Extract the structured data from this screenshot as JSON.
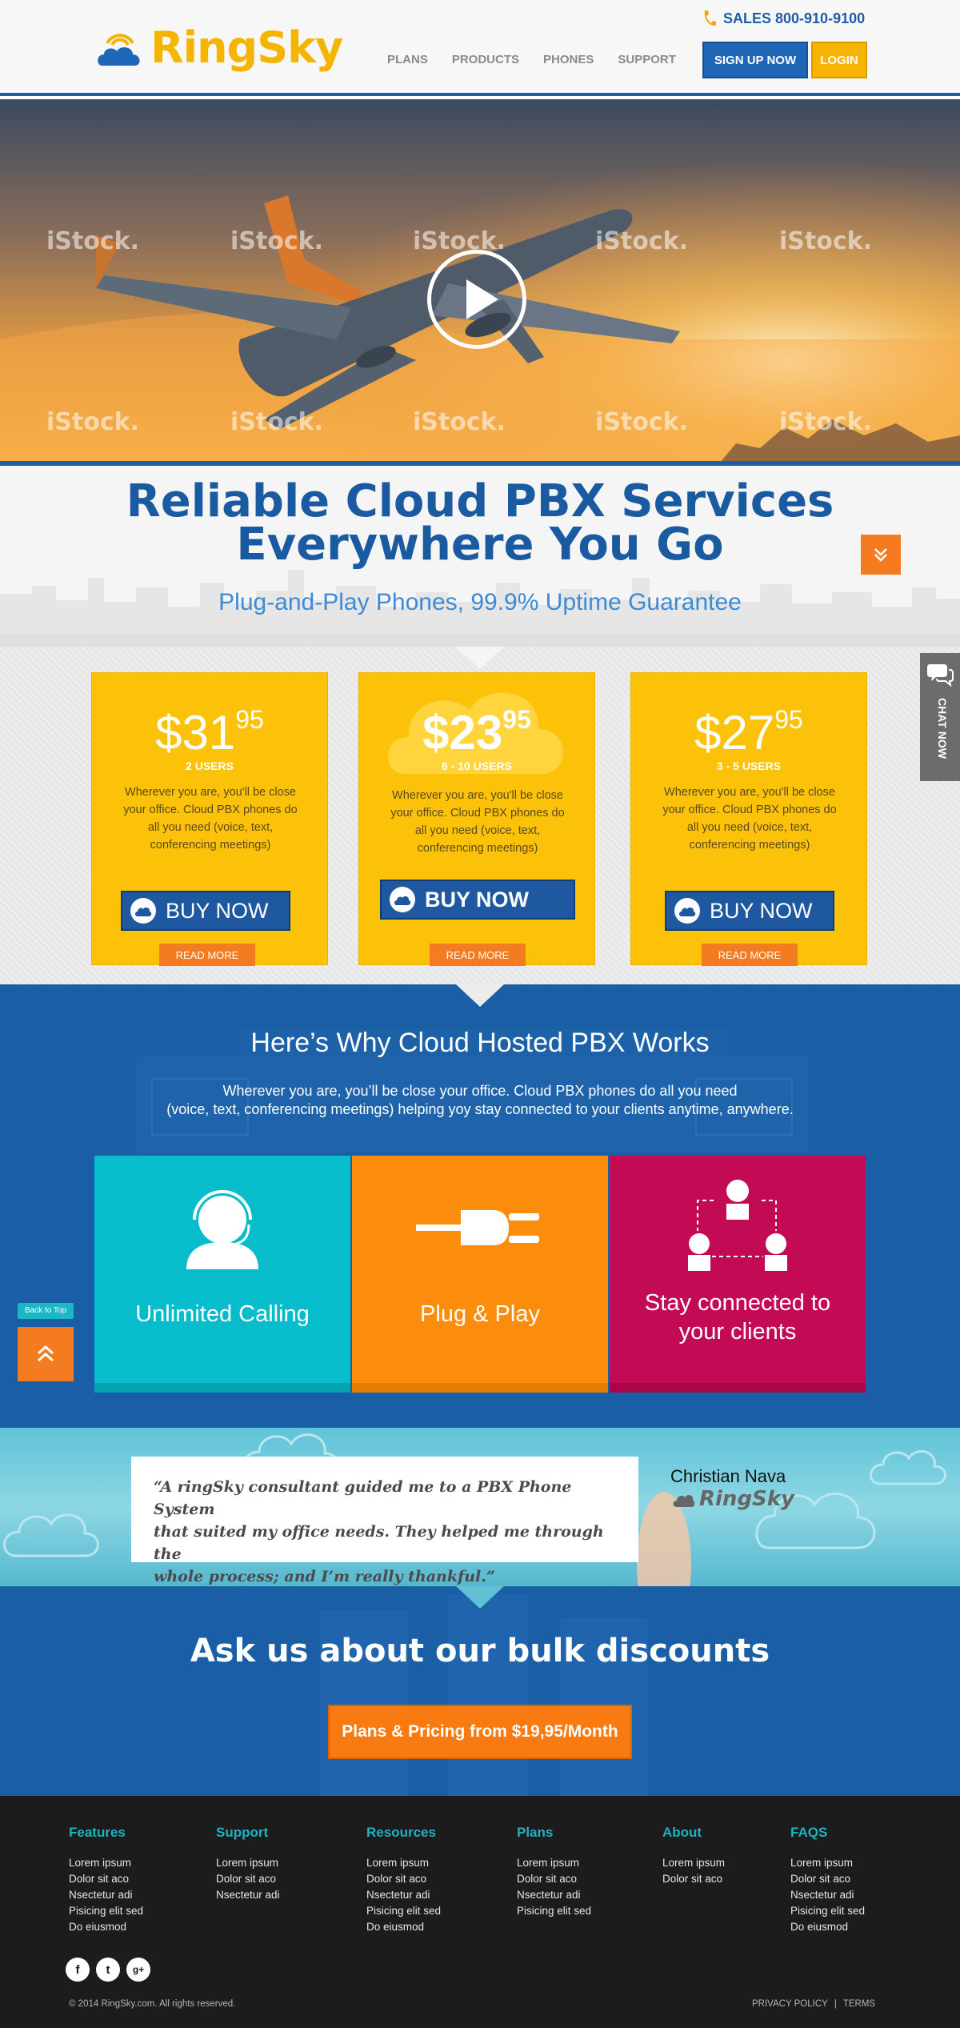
{
  "brand": {
    "name": "RingSky",
    "primary": "#1f5da8",
    "accent": "#f5b400",
    "orange": "#f47b20"
  },
  "header": {
    "nav": [
      "PLANS",
      "PRODUCTS",
      "PHONES",
      "SUPPORT"
    ],
    "sales": "SALES 800-910-9100",
    "signup": "SIGN UP NOW",
    "login": "LOGIN"
  },
  "hero": {
    "watermark": "iStock.",
    "play_icon": "play-icon"
  },
  "headline": {
    "line1": "Reliable Cloud PBX Services",
    "line2": "Everywhere You Go",
    "subtitle": "Plug-and-Play Phones, 99.9% Uptime Guarantee"
  },
  "plans": [
    {
      "dollars": "$31",
      "cents": "95",
      "users": "2 USERS",
      "desc": "Wherever you are, you'll be close your office. Cloud PBX phones do all you need (voice, text, conferencing meetings)",
      "buy": "BUY NOW",
      "more": "READ MORE"
    },
    {
      "dollars": "$23",
      "cents": "95",
      "users": "6 - 10 USERS",
      "desc": "Wherever you are, you'll be close your office. Cloud PBX phones do all you need (voice, text, conferencing meetings)",
      "buy": "BUY NOW",
      "more": "READ MORE"
    },
    {
      "dollars": "$27",
      "cents": "95",
      "users": "3 - 5 USERS",
      "desc": "Wherever you are, you'll be close your office. Cloud PBX phones do all you need (voice, text, conferencing meetings)",
      "buy": "BUY NOW",
      "more": "READ MORE"
    }
  ],
  "why": {
    "title": "Here’s Why Cloud Hosted PBX Works",
    "desc1": "Wherever you are, you’ll be close your office. Cloud PBX phones do all you need",
    "desc2": "(voice, text, conferencing meetings) helping yoy stay connected to your clients anytime, anywhere.",
    "tiles": [
      {
        "label": "Unlimited Calling",
        "color": "#07bccb"
      },
      {
        "label": "Plug & Play",
        "color": "#fb8c0c"
      },
      {
        "label1": "Stay connected to",
        "label2": "your clients",
        "color": "#c30a54"
      }
    ],
    "back_to_top": "Back to Top"
  },
  "testimonial": {
    "quote1": "“A ringSky consultant guided me to a PBX Phone System",
    "quote2": "that suited my office needs. They helped me through the",
    "quote3": "whole process; and I’m really thankful.”",
    "author": "Christian Nava",
    "company": "RingSky"
  },
  "bulk": {
    "title": "Ask  us about our bulk discounts",
    "button": "Plans & Pricing from $19,95/Month"
  },
  "chat": {
    "label": "CHAT NOW"
  },
  "footer": {
    "columns": [
      {
        "title": "Features",
        "links": [
          "Lorem ipsum",
          "Dolor sit aco",
          "Nsectetur adi",
          "Pisicing elit sed",
          "Do eiusmod"
        ]
      },
      {
        "title": "Support",
        "links": [
          "Lorem ipsum",
          "Dolor sit aco",
          "Nsectetur adi"
        ]
      },
      {
        "title": "Resources",
        "links": [
          "Lorem ipsum",
          "Dolor sit aco",
          "Nsectetur adi",
          "Pisicing elit sed",
          "Do eiusmod"
        ]
      },
      {
        "title": "Plans",
        "links": [
          "Lorem ipsum",
          "Dolor sit aco",
          "Nsectetur adi",
          "Pisicing elit sed"
        ]
      },
      {
        "title": "About",
        "links": [
          "Lorem ipsum",
          "Dolor sit aco"
        ]
      },
      {
        "title": "FAQS",
        "links": [
          "Lorem ipsum",
          "Dolor sit aco",
          "Nsectetur adi",
          "Pisicing elit sed",
          "Do eiusmod"
        ]
      }
    ],
    "social": [
      "f",
      "t",
      "g+"
    ],
    "copyright": "© 2014  RingSky.com. All rights reserved.",
    "privacy": "PRIVACY POLICY",
    "sep": "|",
    "terms": "TERMS"
  }
}
